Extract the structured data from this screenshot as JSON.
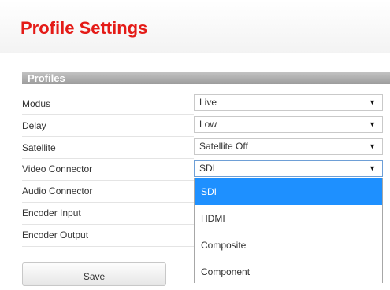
{
  "page": {
    "title": "Profile Settings"
  },
  "section": {
    "title": "Profiles"
  },
  "rows": [
    {
      "label": "Modus",
      "value": "Live"
    },
    {
      "label": "Delay",
      "value": "Low"
    },
    {
      "label": "Satellite",
      "value": "Satellite Off"
    },
    {
      "label": "Video Connector",
      "value": "SDI"
    },
    {
      "label": "Audio Connector"
    },
    {
      "label": "Encoder Input"
    },
    {
      "label": "Encoder Output"
    }
  ],
  "caret_glyph": "▼",
  "dropdown": {
    "for": "Video Connector",
    "selected": "SDI",
    "options": [
      "SDI",
      "HDMI",
      "Composite",
      "Component"
    ]
  },
  "buttons": {
    "save_label": "Save"
  },
  "colors": {
    "title": "#e41b17",
    "section_header": "#a9a9a9",
    "selected_option": "#1e90ff"
  }
}
